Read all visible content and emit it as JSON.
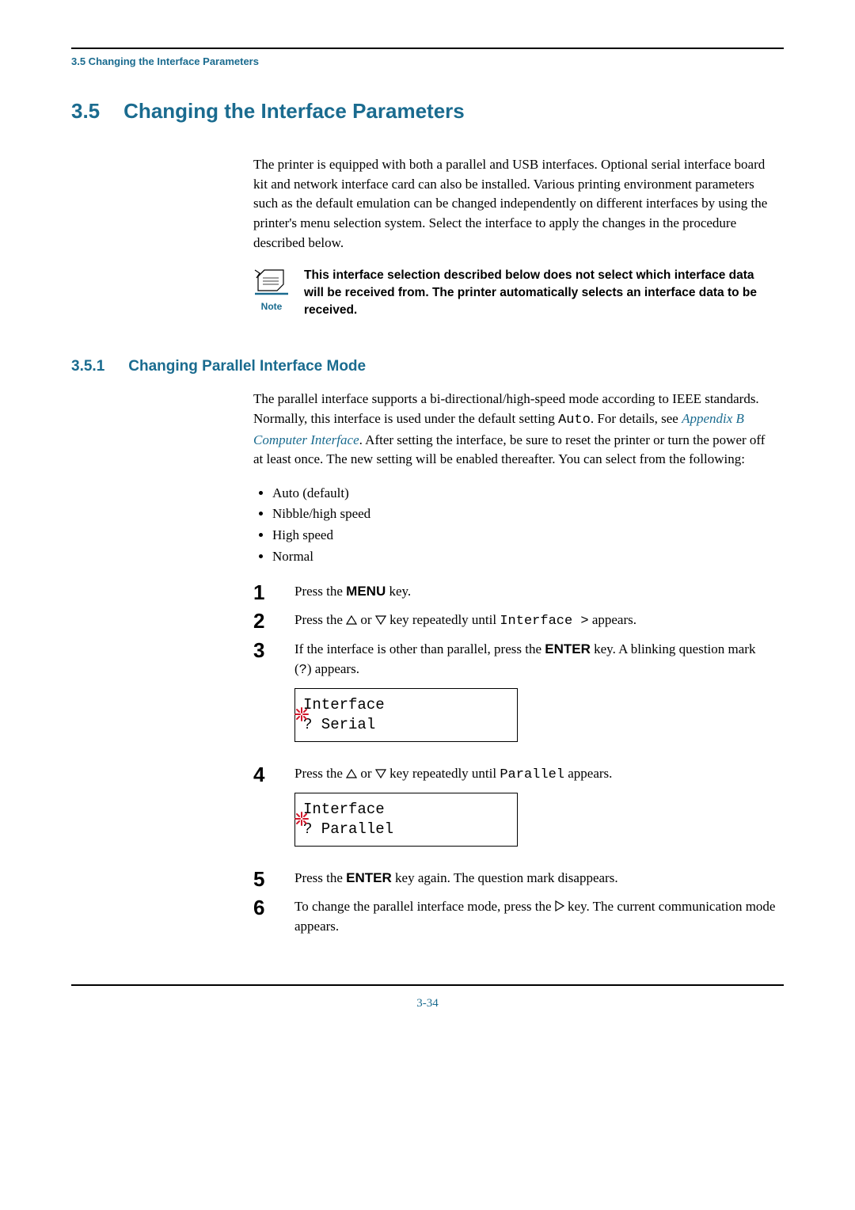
{
  "breadcrumb": "3.5 Changing the Interface Parameters",
  "section": {
    "number": "3.5",
    "title": "Changing the Interface Parameters",
    "intro": "The printer is equipped with both a parallel and USB interfaces. Optional serial interface board kit and network interface card can also be installed. Various printing environment parameters such as the default emulation can be changed independently on different interfaces by using the printer's menu selection system. Select the interface to apply the changes in the procedure described below.",
    "note_label": "Note",
    "note_text": "This interface selection described below does not select which interface data will be received from. The printer automatically selects an interface data to be received."
  },
  "subsection": {
    "number": "3.5.1",
    "title": "Changing Parallel Interface Mode",
    "intro_before_mono": "The parallel interface supports a bi-directional/high-speed mode according to IEEE standards. Normally, this interface is used under the default setting ",
    "intro_mono": "Auto",
    "intro_after_mono1": ". For details, see ",
    "link_text": "Appendix B Computer Interface",
    "intro_after_link": ". After setting the interface, be sure to reset the printer or turn the power off at least once. The new setting will be enabled thereafter. You can select from the following:",
    "options": [
      "Auto (default)",
      "Nibble/high speed",
      "High speed",
      "Normal"
    ],
    "steps": {
      "s1_a": "Press the ",
      "s1_key": "MENU",
      "s1_b": " key.",
      "s2_a": "Press the ",
      "s2_b": " or ",
      "s2_c": " key repeatedly until ",
      "s2_mono": "Interface >",
      "s2_d": " appears.",
      "s3_a": "If the interface is other than parallel, press the ",
      "s3_key": "ENTER",
      "s3_b": " key. A blinking question mark (",
      "s3_mono": "?",
      "s3_c": ") appears.",
      "s3_lcd_line1": "Interface",
      "s3_lcd_line2": "? Serial",
      "s4_a": "Press the ",
      "s4_b": " or ",
      "s4_c": " key repeatedly until ",
      "s4_mono": "Parallel",
      "s4_d": " appears.",
      "s4_lcd_line1": "Interface",
      "s4_lcd_line2": "? Parallel",
      "s5_a": "Press the ",
      "s5_key": "ENTER",
      "s5_b": " key again. The question mark disappears.",
      "s6_a": "To change the parallel interface mode, press the ",
      "s6_b": " key. The current communication mode appears."
    }
  },
  "page_number": "3-34"
}
